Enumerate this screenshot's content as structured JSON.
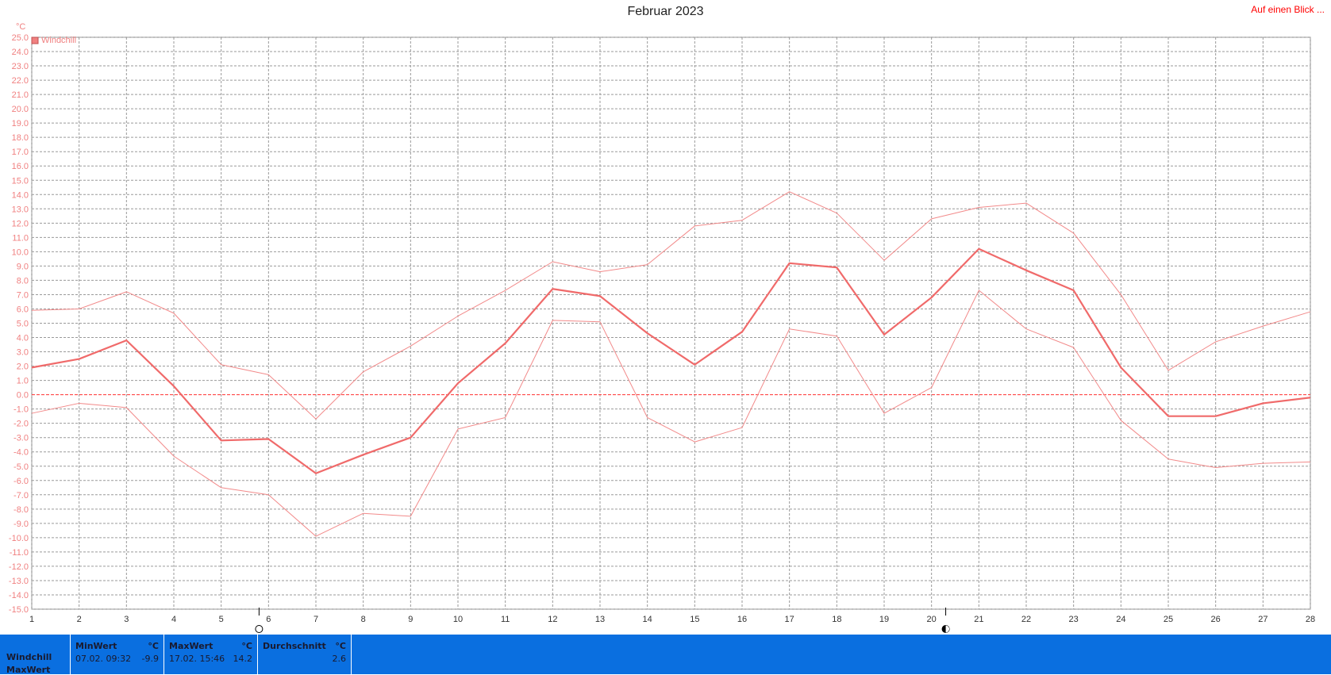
{
  "link": "Auf einen Blick ...",
  "chart_data": {
    "type": "line",
    "title": "Februar 2023",
    "ylabel": "°C",
    "legend": [
      "Windchill"
    ],
    "legend_position": "top-left",
    "grid": true,
    "x": [
      1,
      2,
      3,
      4,
      5,
      6,
      7,
      8,
      9,
      10,
      11,
      12,
      13,
      14,
      15,
      16,
      17,
      18,
      19,
      20,
      21,
      22,
      23,
      24,
      25,
      26,
      27,
      28
    ],
    "xlim": [
      1,
      28
    ],
    "ylim": [
      -15,
      25
    ],
    "y_ticks": [
      "25.0",
      "24.0",
      "23.0",
      "22.0",
      "21.0",
      "20.0",
      "19.0",
      "18.0",
      "17.0",
      "16.0",
      "15.0",
      "14.0",
      "13.0",
      "12.0",
      "11.0",
      "10.0",
      "9.0",
      "8.0",
      "7.0",
      "6.0",
      "5.0",
      "4.0",
      "3.0",
      "2.0",
      "1.0",
      "0.0",
      "-1.0",
      "-2.0",
      "-3.0",
      "-4.0",
      "-5.0",
      "-6.0",
      "-7.0",
      "-8.0",
      "-9.0",
      "-10.0",
      "-11.0",
      "-12.0",
      "-13.0",
      "-14.0",
      "-15.0"
    ],
    "x_ticks": [
      "1",
      "2",
      "3",
      "4",
      "5",
      "6",
      "7",
      "8",
      "9",
      "10",
      "11",
      "12",
      "13",
      "14",
      "15",
      "16",
      "17",
      "18",
      "19",
      "20",
      "21",
      "22",
      "23",
      "24",
      "25",
      "26",
      "27",
      "28"
    ],
    "reference_line": 0,
    "series": [
      {
        "name": "Windchill",
        "role": "max",
        "values": [
          5.9,
          6.0,
          7.2,
          5.7,
          2.1,
          1.4,
          -1.7,
          1.6,
          3.4,
          5.5,
          7.3,
          9.3,
          8.6,
          9.1,
          11.8,
          12.2,
          14.2,
          12.7,
          9.4,
          12.3,
          13.1,
          13.4,
          11.3,
          7.0,
          1.7,
          3.7,
          4.8,
          5.8
        ]
      },
      {
        "name": "Windchill",
        "role": "avg",
        "values": [
          1.9,
          2.5,
          3.8,
          0.6,
          -3.2,
          -3.1,
          -5.5,
          -4.2,
          -3.0,
          0.8,
          3.6,
          7.4,
          6.9,
          4.3,
          2.1,
          4.4,
          9.2,
          8.9,
          4.2,
          6.8,
          10.2,
          8.7,
          7.3,
          1.9,
          -1.5,
          -1.5,
          -0.6,
          -0.2
        ]
      },
      {
        "name": "Windchill",
        "role": "min",
        "values": [
          -1.3,
          -0.6,
          -0.9,
          -4.3,
          -6.5,
          -7.0,
          -9.9,
          -8.3,
          -8.5,
          -2.4,
          -1.6,
          5.2,
          5.1,
          -1.6,
          -3.3,
          -2.3,
          4.6,
          4.1,
          -1.3,
          0.5,
          7.3,
          4.6,
          3.3,
          -1.8,
          -4.5,
          -5.1,
          -4.8,
          -4.7
        ]
      }
    ],
    "moon_markers": [
      {
        "x": 5.8,
        "phase": "full-moon"
      },
      {
        "x": 20.3,
        "phase": "last-quarter"
      }
    ]
  },
  "stats": {
    "row1_label": "Windchill",
    "row2_label": "MaxWert",
    "min": {
      "header": "MinWert",
      "unit": "°C",
      "date": "07.02.  09:32",
      "value": "-9.9"
    },
    "max": {
      "header": "MaxWert",
      "unit": "°C",
      "date": "17.02.  15:46",
      "value": "14.2"
    },
    "avg": {
      "header": "Durchschnitt",
      "unit": "°C",
      "date": "",
      "value": "2.6"
    }
  }
}
